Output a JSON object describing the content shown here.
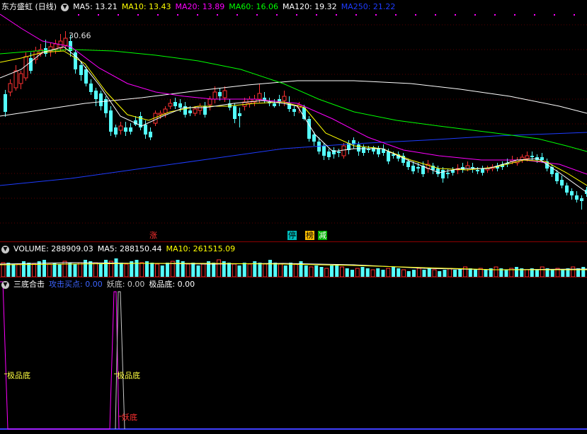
{
  "price_pane": {
    "title": "东方盛虹 (日线)",
    "ma": [
      {
        "label": "MA5: 13.21",
        "color": "#ffffff"
      },
      {
        "label": "MA10: 13.43",
        "color": "#ffff00"
      },
      {
        "label": "MA20: 13.89",
        "color": "#ff00ff"
      },
      {
        "label": "MA60: 16.06",
        "color": "#00ff00"
      },
      {
        "label": "MA120: 19.32",
        "color": "#ffffff"
      },
      {
        "label": "MA250: 21.22",
        "color": "#1e3cff"
      }
    ],
    "high_marker": "30.66",
    "signal_tags": [
      {
        "text": "涨",
        "bg": "#ff3030",
        "color": "#ffffff"
      },
      {
        "text": "停",
        "bg": "#00c0c0",
        "color": "#000000"
      },
      {
        "text": "榜",
        "bg": "#ffbf00",
        "color": "#000000"
      },
      {
        "text": "减",
        "bg": "#00b000",
        "color": "#ffffff"
      }
    ]
  },
  "volume_pane": {
    "title": "VOLUME: 288909.03",
    "ma5": "MA5: 288150.44",
    "ma10": "MA10: 261515.09"
  },
  "indicator_pane": {
    "title": "三底合击",
    "items": [
      {
        "label": "攻击买点: 0.00",
        "color": "#3c64ff"
      },
      {
        "label": "妖底: 0.00",
        "color": "#c8c8c8"
      },
      {
        "label": "极品底: 0.00",
        "color": "#ffffff"
      }
    ],
    "annotations": {
      "jipin_1": "极品底",
      "jipin_2": "极品底",
      "yaodi": "妖底"
    }
  },
  "colors": {
    "up": "#ff3232",
    "down": "#54ffff",
    "ma5": "#ffffff",
    "ma10": "#ffff00",
    "ma20": "#ff00ff",
    "ma60": "#00ff00",
    "ma120": "#ffffff",
    "ma250": "#1e3cff",
    "indicator_line": "#ff00ff",
    "indicator_base": "#4040ff"
  }
}
